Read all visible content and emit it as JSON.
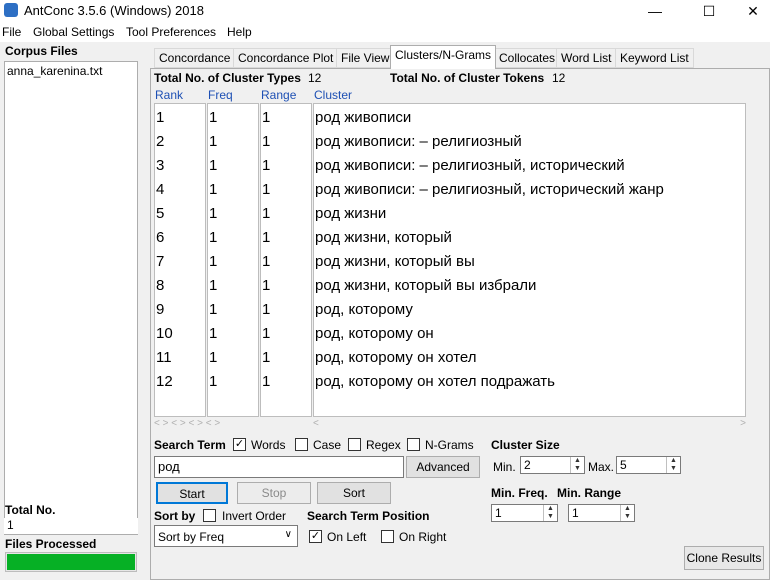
{
  "window": {
    "title": "AntConc 3.5.6 (Windows) 2018",
    "minimize_glyph": "—",
    "maximize_glyph": "☐",
    "close_glyph": "✕"
  },
  "menu": [
    "File",
    "Global Settings",
    "Tool Preferences",
    "Help"
  ],
  "left": {
    "corpus_files_label": "Corpus Files",
    "files": [
      "anna_karenina.txt"
    ],
    "total_no_label": "Total No.",
    "total_no_value": "1",
    "files_processed_label": "Files Processed",
    "files_processed_fraction": 1.0
  },
  "tabs": [
    "Concordance",
    "Concordance Plot",
    "File View",
    "Clusters/N-Grams",
    "Collocates",
    "Word List",
    "Keyword List"
  ],
  "active_tab": "Clusters/N-Grams",
  "stats": {
    "types_label": "Total No. of Cluster Types",
    "types_value": "12",
    "tokens_label": "Total No. of Cluster Tokens",
    "tokens_value": "12"
  },
  "columns": [
    "Rank",
    "Freq",
    "Range",
    "Cluster"
  ],
  "rows": [
    {
      "rank": "1",
      "freq": "1",
      "range": "1",
      "cluster": "род живописи"
    },
    {
      "rank": "2",
      "freq": "1",
      "range": "1",
      "cluster": "род живописи: – религиозный"
    },
    {
      "rank": "3",
      "freq": "1",
      "range": "1",
      "cluster": "род живописи: – религиозный, исторический"
    },
    {
      "rank": "4",
      "freq": "1",
      "range": "1",
      "cluster": "род живописи: – религиозный, исторический жанр"
    },
    {
      "rank": "5",
      "freq": "1",
      "range": "1",
      "cluster": "род жизни"
    },
    {
      "rank": "6",
      "freq": "1",
      "range": "1",
      "cluster": "род жизни, который"
    },
    {
      "rank": "7",
      "freq": "1",
      "range": "1",
      "cluster": "род жизни, который вы"
    },
    {
      "rank": "8",
      "freq": "1",
      "range": "1",
      "cluster": "род жизни, который вы избрали"
    },
    {
      "rank": "9",
      "freq": "1",
      "range": "1",
      "cluster": "род, которому"
    },
    {
      "rank": "10",
      "freq": "1",
      "range": "1",
      "cluster": "род, которому он"
    },
    {
      "rank": "11",
      "freq": "1",
      "range": "1",
      "cluster": "род, которому он хотел"
    },
    {
      "rank": "12",
      "freq": "1",
      "range": "1",
      "cluster": "род, которому он хотел подражать"
    }
  ],
  "search": {
    "label": "Search Term",
    "words_label": "Words",
    "words_checked": true,
    "case_label": "Case",
    "case_checked": false,
    "regex_label": "Regex",
    "regex_checked": false,
    "ngrams_label": "N-Grams",
    "ngrams_checked": false,
    "term_value": "род",
    "advanced_label": "Advanced",
    "start_label": "Start",
    "stop_label": "Stop",
    "sort_label": "Sort"
  },
  "cluster_size": {
    "label": "Cluster Size",
    "min_label": "Min.",
    "min_value": "2",
    "max_label": "Max.",
    "max_value": "5"
  },
  "min_freq": {
    "label": "Min. Freq.",
    "value": "1"
  },
  "min_range": {
    "label": "Min. Range",
    "value": "1"
  },
  "sort_by": {
    "label": "Sort by",
    "invert_label": "Invert Order",
    "invert_checked": false,
    "selected": "Sort by Freq"
  },
  "position": {
    "label": "Search Term Position",
    "on_left_label": "On Left",
    "on_left_checked": true,
    "on_right_label": "On Right",
    "on_right_checked": false
  },
  "clone_label": "Clone Results",
  "scroll_glyphs": "< > < > < > < >",
  "colors": {
    "header_text": "#1e50b4",
    "progress": "#06b025",
    "app_icon": "#2d6fc4"
  }
}
